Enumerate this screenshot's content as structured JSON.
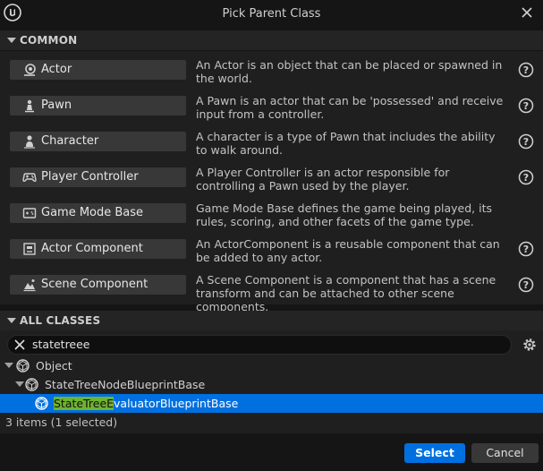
{
  "window": {
    "title": "Pick Parent Class",
    "logo_icon": "unreal-logo-icon",
    "close_icon": "close-icon"
  },
  "common": {
    "header": "COMMON",
    "items": [
      {
        "label": "Actor",
        "icon": "actor-icon",
        "description": "An Actor is an object that can be placed or spawned in the world."
      },
      {
        "label": "Pawn",
        "icon": "pawn-icon",
        "description": "A Pawn is an actor that can be 'possessed' and receive input from a controller."
      },
      {
        "label": "Character",
        "icon": "character-icon",
        "description": "A character is a type of Pawn that includes the ability to walk around."
      },
      {
        "label": "Player Controller",
        "icon": "gamepad-icon",
        "description": "A Player Controller is an actor responsible for controlling a Pawn used by the player."
      },
      {
        "label": "Game Mode Base",
        "icon": "game-mode-icon",
        "description": "Game Mode Base defines the game being played, its rules, scoring, and other facets of the game type."
      },
      {
        "label": "Actor Component",
        "icon": "actor-component-icon",
        "description": "An ActorComponent is a reusable component that can be added to any actor."
      },
      {
        "label": "Scene Component",
        "icon": "scene-component-icon",
        "description": "A Scene Component is a component that has a scene transform and can be attached to other scene components."
      }
    ]
  },
  "all_classes": {
    "header": "ALL CLASSES",
    "search": {
      "value": "statetreee"
    },
    "tree": [
      {
        "label": "Object"
      },
      {
        "label": "StateTreeNodeBlueprintBase"
      },
      {
        "label_highlight": "StateTreeE",
        "label_rest": "valuatorBlueprintBase",
        "selected": true
      }
    ],
    "status": "3 items (1 selected)"
  },
  "footer": {
    "select_label": "Select",
    "cancel_label": "Cancel"
  },
  "colors": {
    "accent": "#0070e0",
    "search_highlight": "#6fb32f",
    "background": "#151515",
    "panel": "#1f1f1f"
  }
}
